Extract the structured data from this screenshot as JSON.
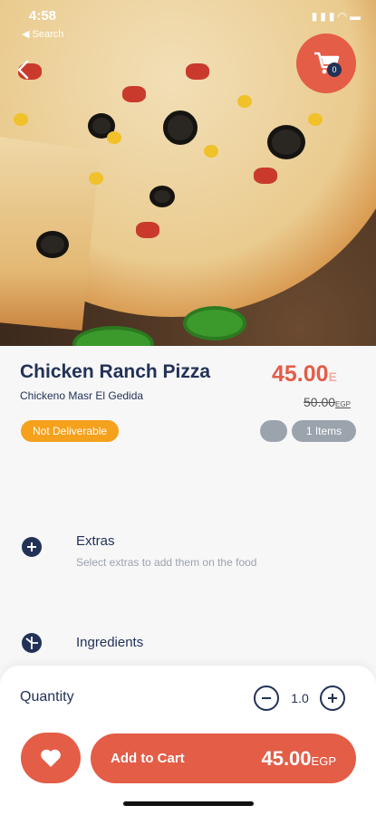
{
  "status_bar": {
    "time": "4:58",
    "back_app": "◀ Search"
  },
  "header": {
    "cart_count": "0"
  },
  "product": {
    "title": "Chicken Ranch Pizza",
    "restaurant": "Chickeno Masr El Gedida",
    "price": "45.00",
    "price_currency": "E",
    "old_price": "50.00",
    "old_price_currency": "EGP",
    "availability_badge": "Not Deliverable",
    "items_label": "1 Items"
  },
  "sections": {
    "extras": {
      "title": "Extras",
      "description": "Select extras to add them on the food"
    },
    "ingredients": {
      "title": "Ingredients"
    }
  },
  "footer": {
    "quantity_label": "Quantity",
    "quantity_value": "1.0",
    "add_to_cart_label": "Add to Cart",
    "total_price": "45.00",
    "total_currency": "EGP"
  },
  "colors": {
    "accent": "#e35d47",
    "navy": "#223257",
    "badge": "#f5a11c",
    "muted": "#9ba3ad"
  },
  "icons": {
    "back": "chevron-left-icon",
    "cart": "shopping-cart-icon",
    "extras": "plus-circle-icon",
    "ingredients": "pie-icon",
    "decrease": "minus-icon",
    "increase": "plus-icon",
    "favorite": "heart-icon"
  }
}
